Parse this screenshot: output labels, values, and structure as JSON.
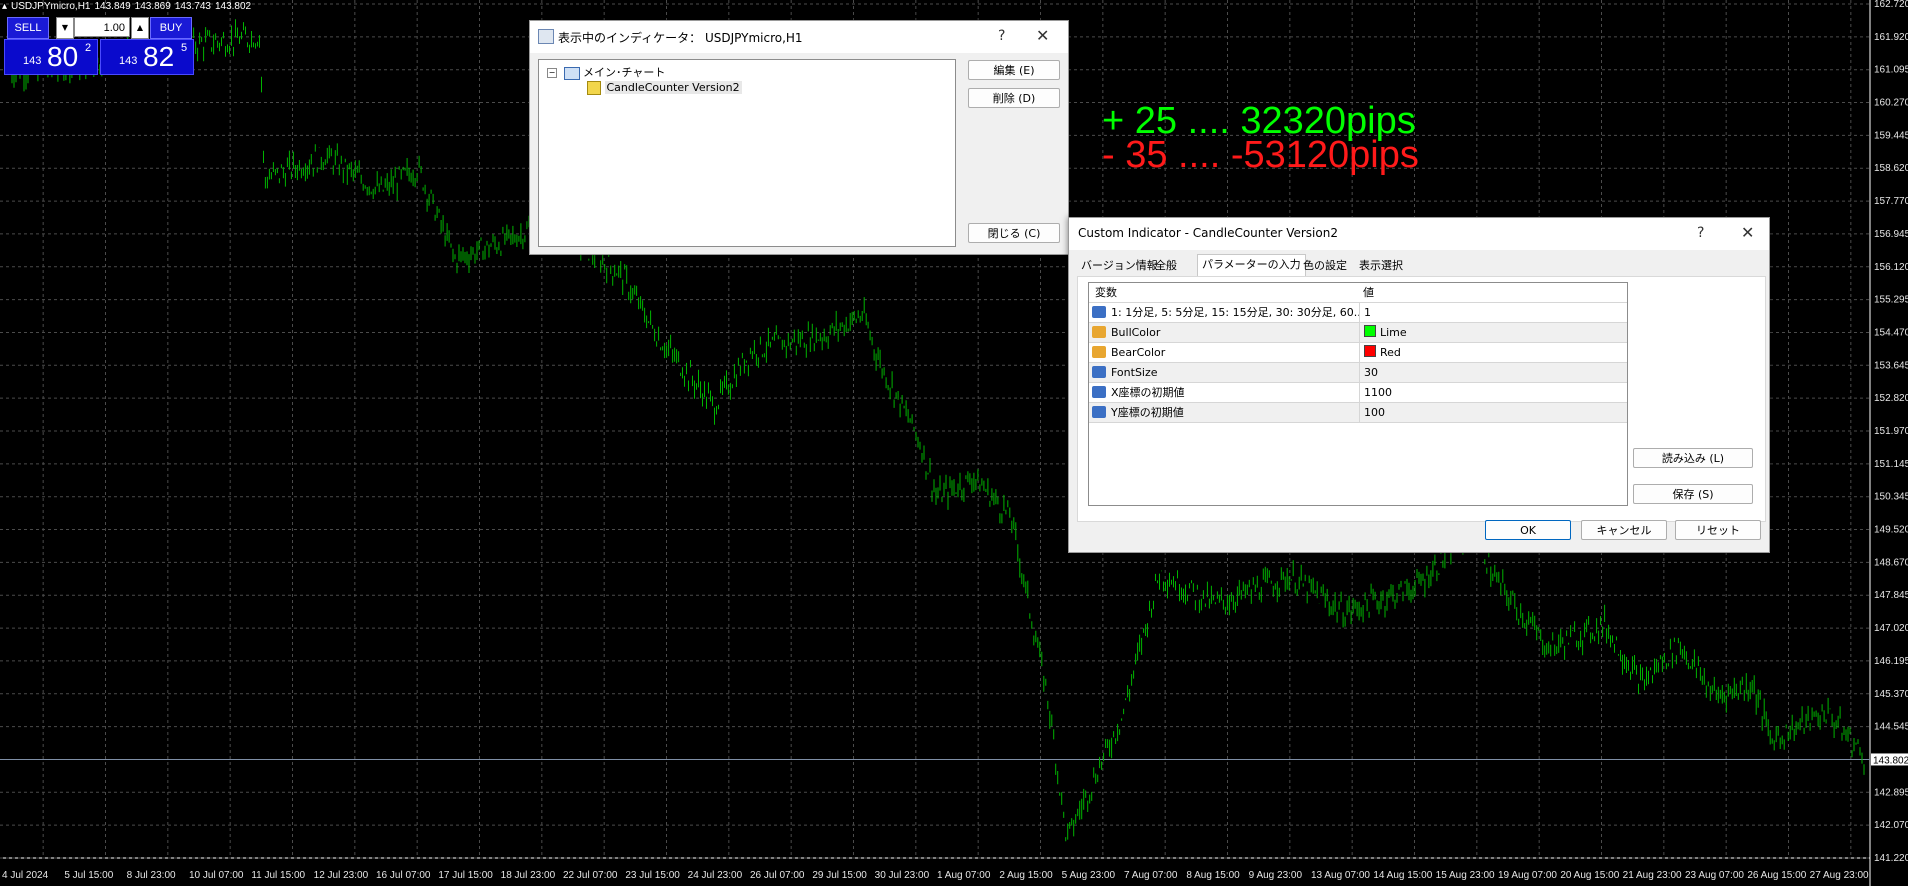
{
  "header": {
    "symbol": "USDJPYmicro,H1",
    "open": "143.849",
    "high": "143.869",
    "low": "143.743",
    "close": "143.802"
  },
  "trade_panel": {
    "sell_label": "SELL",
    "buy_label": "BUY",
    "volume": "1.00",
    "bid_small": "143",
    "bid_big": "80",
    "bid_sup": "2",
    "ask_small": "143",
    "ask_big": "82",
    "ask_sup": "5"
  },
  "overlay_text": {
    "bull_line": "+ 25 .... 32320pips",
    "bear_line": "- 35 .... -53120pips",
    "bull_color": "#00ff00",
    "bear_color": "#ff1a1a"
  },
  "price_axis": {
    "labels": [
      "162.720",
      "161.920",
      "161.095",
      "160.270",
      "159.445",
      "158.620",
      "157.770",
      "156.945",
      "156.120",
      "155.295",
      "154.470",
      "153.645",
      "152.820",
      "151.970",
      "151.145",
      "150.345",
      "149.520",
      "148.670",
      "147.845",
      "147.020",
      "146.195",
      "145.370",
      "144.545",
      "143.802",
      "142.895",
      "142.070",
      "141.220"
    ],
    "current": "143.802"
  },
  "time_axis": {
    "labels": [
      "4 Jul 2024",
      "5 Jul 15:00",
      "8 Jul 23:00",
      "10 Jul 07:00",
      "11 Jul 15:00",
      "12 Jul 23:00",
      "16 Jul 07:00",
      "17 Jul 15:00",
      "18 Jul 23:00",
      "22 Jul 07:00",
      "23 Jul 15:00",
      "24 Jul 23:00",
      "26 Jul 07:00",
      "29 Jul 15:00",
      "30 Jul 23:00",
      "1 Aug 07:00",
      "2 Aug 15:00",
      "5 Aug 23:00",
      "7 Aug 07:00",
      "8 Aug 15:00",
      "9 Aug 23:00",
      "13 Aug 07:00",
      "14 Aug 15:00",
      "15 Aug 23:00",
      "19 Aug 07:00",
      "20 Aug 15:00",
      "21 Aug 23:00",
      "23 Aug 07:00",
      "26 Aug 15:00",
      "27 Aug 23:00"
    ]
  },
  "indicators_dialog": {
    "title": "表示中のインディケータ： USDJPYmicro,H1",
    "help": "?",
    "tree_root": "メイン･チャート",
    "tree_child": "CandleCounter Version2",
    "edit_button": "編集 (E)",
    "delete_button": "削除 (D)",
    "close_button": "閉じる (C)"
  },
  "custom_dialog": {
    "title": "Custom Indicator - CandleCounter Version2",
    "help": "?",
    "tabs": [
      "バージョン情報",
      "全般",
      "パラメーターの入力",
      "色の設定",
      "表示選択"
    ],
    "active_tab": 2,
    "columns": {
      "name": "変数",
      "value": "値"
    },
    "params": [
      {
        "name": "1: 1分足, 5: 5分足, 15: 15分足, 30: 30分足, 60...",
        "value": "1",
        "type": "int"
      },
      {
        "name": "BullColor",
        "value": "Lime",
        "type": "color",
        "swatch": "#00ff00"
      },
      {
        "name": "BearColor",
        "value": "Red",
        "type": "color",
        "swatch": "#ff0000"
      },
      {
        "name": "FontSize",
        "value": "30",
        "type": "int"
      },
      {
        "name": "X座標の初期値",
        "value": "1100",
        "type": "int"
      },
      {
        "name": "Y座標の初期値",
        "value": "100",
        "type": "int"
      }
    ],
    "load_button": "読み込み (L)",
    "save_button": "保存 (S)",
    "ok_button": "OK",
    "cancel_button": "キャンセル",
    "reset_button": "リセット"
  }
}
